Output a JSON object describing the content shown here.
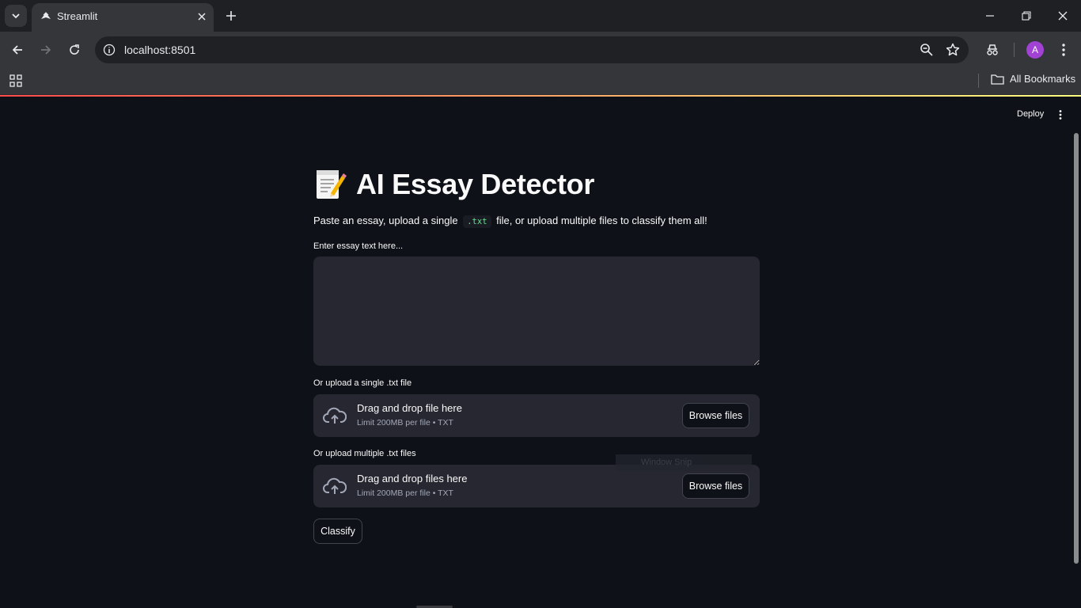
{
  "browser": {
    "tab_title": "Streamlit",
    "url": "localhost:8501",
    "bookmarks_label": "All Bookmarks",
    "profile_initial": "A",
    "profile_color": "#a142d4"
  },
  "app": {
    "header": {
      "deploy_label": "Deploy"
    },
    "title_icon": "memo-icon",
    "title": "AI Essay Detector",
    "subtitle": {
      "before": "Paste an essay, upload a single",
      "code": ".txt",
      "after": "file, or upload multiple files to classify them all!"
    },
    "essay_input": {
      "label": "Enter essay text here...",
      "value": ""
    },
    "single_upload": {
      "label": "Or upload a single .txt file",
      "drop_text": "Drag and drop file here",
      "limit_text": "Limit 200MB per file • TXT",
      "button_label": "Browse files"
    },
    "multi_upload": {
      "label": "Or upload multiple .txt files",
      "drop_text": "Drag and drop files here",
      "limit_text": "Limit 200MB per file • TXT",
      "button_label": "Browse files"
    },
    "classify_label": "Classify",
    "overlay_text": "Window Snip"
  },
  "colors": {
    "background": "#0e1117",
    "widget_background": "#262730",
    "accent_gradient_start": "#ff4b4b",
    "accent_gradient_end": "#fffd80",
    "code_text": "#5ce488"
  }
}
